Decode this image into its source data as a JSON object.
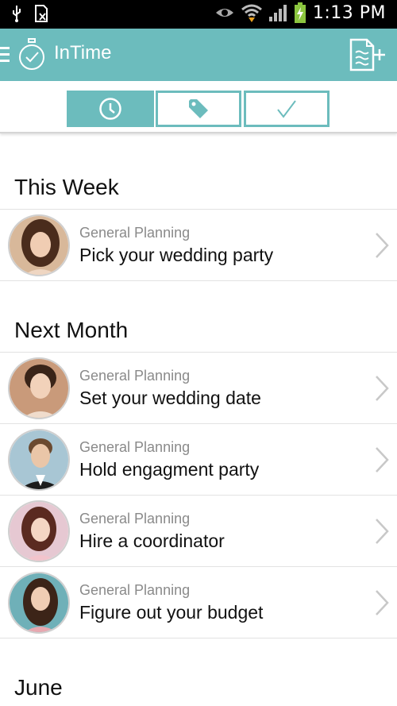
{
  "statusbar": {
    "time": "1:13 PM",
    "icons": [
      "usb-icon",
      "no-sim-icon",
      "eye-icon",
      "wifi-icon",
      "signal-icon",
      "battery-charging-icon"
    ]
  },
  "appbar": {
    "title": "InTime",
    "icons": [
      "menu-icon",
      "stopwatch-logo-icon",
      "add-document-icon"
    ]
  },
  "tabs": [
    {
      "icon": "clock-icon",
      "selected": true
    },
    {
      "icon": "tag-icon",
      "selected": false
    },
    {
      "icon": "checkmark-icon",
      "selected": false
    }
  ],
  "colors": {
    "accent": "#6cbcbd"
  },
  "sections": [
    {
      "title": "This Week",
      "items": [
        {
          "category": "General Planning",
          "title": "Pick your wedding party"
        }
      ]
    },
    {
      "title": "Next Month",
      "items": [
        {
          "category": "General Planning",
          "title": "Set your wedding date"
        },
        {
          "category": "General Planning",
          "title": "Hold engagment party"
        },
        {
          "category": "General Planning",
          "title": "Hire a coordinator"
        },
        {
          "category": "General Planning",
          "title": "Figure out your budget"
        }
      ]
    },
    {
      "title": "June",
      "items": []
    }
  ]
}
